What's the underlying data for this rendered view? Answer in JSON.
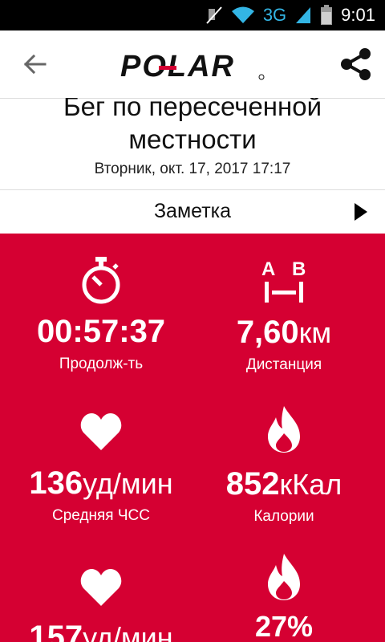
{
  "status_bar": {
    "network": "3G",
    "time": "9:01"
  },
  "header": {
    "brand": "POLAR"
  },
  "session": {
    "title": "Бег по пересеченной местности",
    "date": "Вторник, окт. 17, 2017 17:17"
  },
  "note": {
    "label": "Заметка"
  },
  "stats": [
    {
      "value": "00:57:37",
      "unit": "",
      "label": "Продолж-ть",
      "icon": "stopwatch-icon"
    },
    {
      "value": "7,60",
      "unit": "км",
      "label": "Дистанция",
      "icon": "distance-ab-icon"
    },
    {
      "value": "136",
      "unit": "уд/мин",
      "label": "Средняя ЧСС",
      "icon": "heart-icon"
    },
    {
      "value": "852",
      "unit": "кКал",
      "label": "Калории",
      "icon": "flame-icon"
    },
    {
      "value": "157",
      "unit": "уд/мин",
      "label": "",
      "icon": "heart-icon"
    },
    {
      "value": "27%",
      "unit": "",
      "label": "",
      "icon": "flame-icon"
    }
  ],
  "colors": {
    "accent": "#d50032",
    "status_bar": "#000000",
    "network": "#33b5e5"
  }
}
